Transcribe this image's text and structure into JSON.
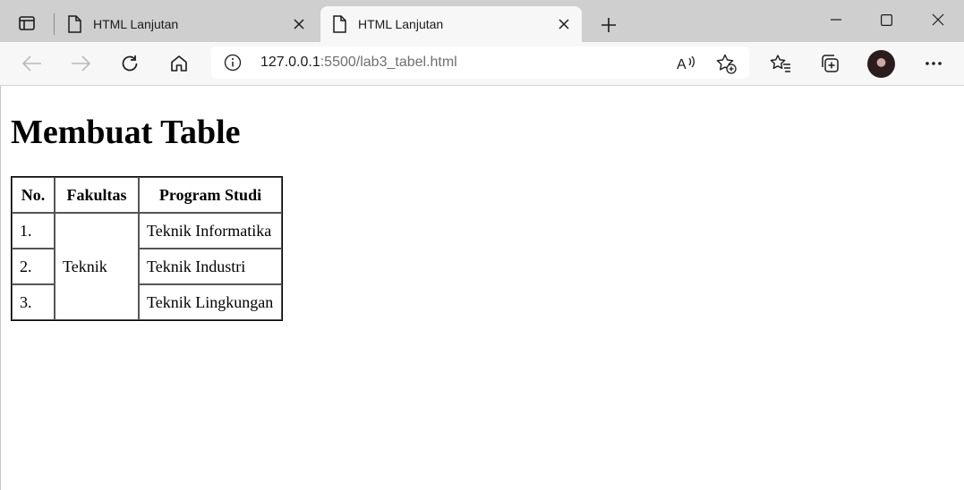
{
  "browser": {
    "tabs": [
      {
        "title": "HTML Lanjutan",
        "active": false
      },
      {
        "title": "HTML Lanjutan",
        "active": true
      }
    ],
    "address": {
      "host": "127.0.0.1",
      "rest": ":5500/lab3_tabel.html"
    },
    "icons": {
      "tab_actions": "tab-actions-icon",
      "favicon": "page-icon",
      "close": "close-icon",
      "new_tab": "plus-icon",
      "back": "back-arrow-icon",
      "forward": "forward-arrow-icon",
      "refresh": "refresh-icon",
      "home": "home-icon",
      "info": "info-icon",
      "read_aloud": "read-aloud-icon",
      "favorite_add": "star-add-icon",
      "favorites": "favorites-icon",
      "collections": "collections-icon",
      "profile": "avatar",
      "more": "more-icon"
    }
  },
  "page": {
    "heading": "Membuat Table",
    "table": {
      "headers": [
        "No.",
        "Fakultas",
        "Program Studi"
      ],
      "faculty": "Teknik",
      "rows": [
        {
          "no": "1.",
          "program": "Teknik Informatika"
        },
        {
          "no": "2.",
          "program": "Teknik Industri"
        },
        {
          "no": "3.",
          "program": "Teknik Lingkungan"
        }
      ]
    }
  }
}
